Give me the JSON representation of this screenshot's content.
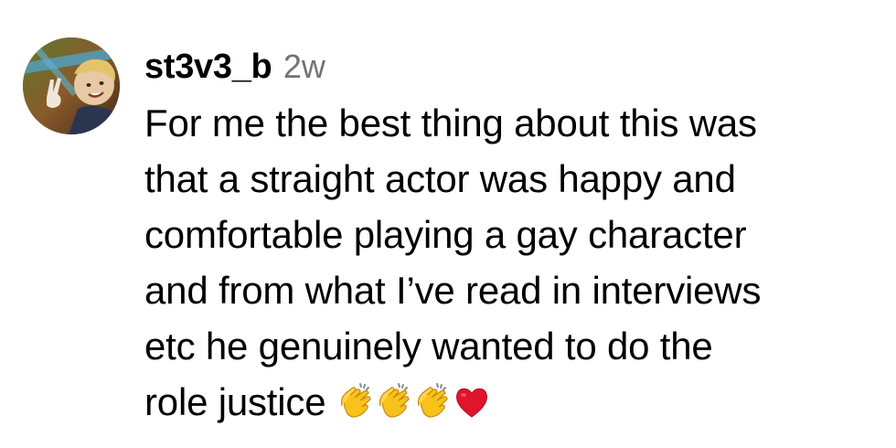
{
  "comment": {
    "username": "st3v3_b",
    "timestamp": "2w",
    "text_lines": [
      "For me the best thing about this was",
      "that a straight actor was happy and",
      "comfortable playing a gay character",
      "and from what I’ve read in interviews",
      "etc he genuinely wanted to do the",
      "role justice"
    ],
    "emojis": [
      "clapping-hands-emoji",
      "clapping-hands-emoji",
      "clapping-hands-emoji",
      "red-heart-emoji"
    ]
  },
  "colors": {
    "username": "#000000",
    "timestamp": "#737373",
    "text": "#000000",
    "background": "#ffffff",
    "heart": "#e0142b",
    "clap": "#f7c21a"
  }
}
